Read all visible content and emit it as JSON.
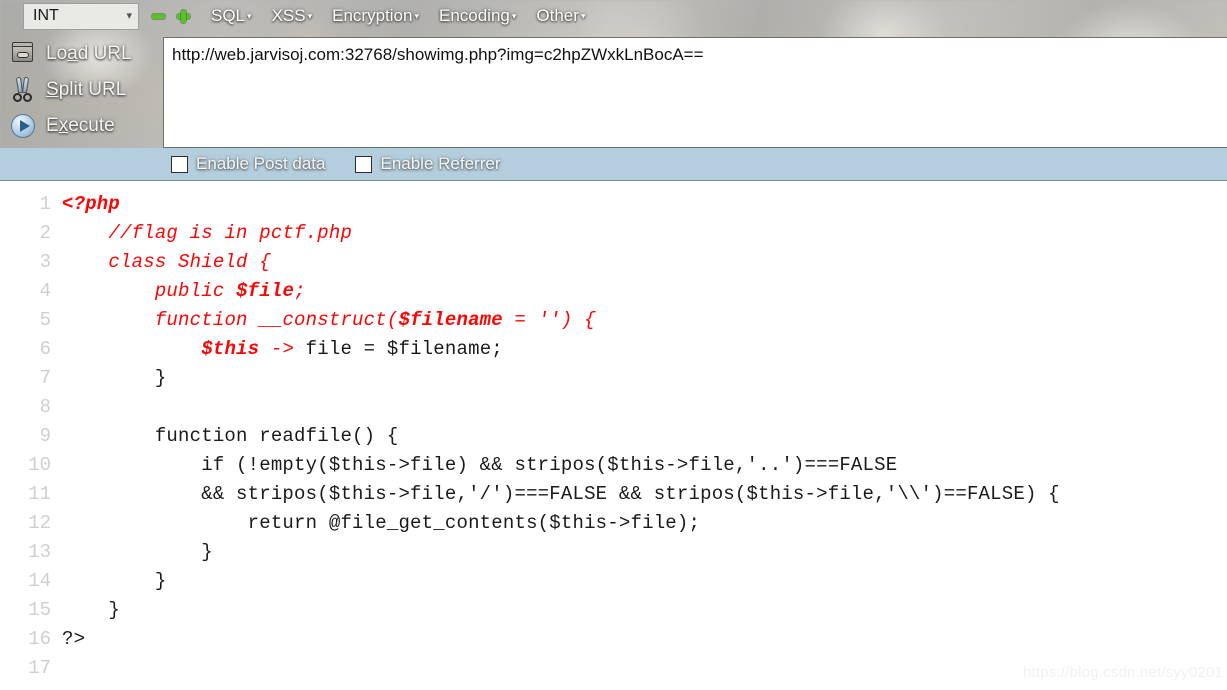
{
  "hackbar": {
    "encoding_select": {
      "value": "INT",
      "chevron": "chevron-down-icon"
    },
    "zoom_out_label": "−",
    "zoom_in_label": "+",
    "menus": [
      {
        "label": "SQL",
        "caret": "▾"
      },
      {
        "label": "XSS",
        "caret": "▾"
      },
      {
        "label": "Encryption",
        "caret": "▾"
      },
      {
        "label": "Encoding",
        "caret": "▾"
      },
      {
        "label": "Other",
        "caret": "▾"
      }
    ],
    "actions": [
      {
        "label_pre": "Lo",
        "label_key": "a",
        "label_post": "d URL",
        "icon": "load-url-icon"
      },
      {
        "label_pre": "",
        "label_key": "S",
        "label_post": "plit URL",
        "icon": "scissors-icon"
      },
      {
        "label_pre": "E",
        "label_key": "x",
        "label_post": "ecute",
        "icon": "play-circle-icon"
      }
    ],
    "url_value": "http://web.jarvisoj.com:32768/showimg.php?img=c2hpZWxkLnBocA==",
    "checkboxes": [
      {
        "label": "Enable Post data",
        "checked": false
      },
      {
        "label": "Enable Referrer",
        "checked": false
      }
    ]
  },
  "code": {
    "lines": [
      {
        "n": "1",
        "html": "<span class=\"rb\">&lt;?php</span>"
      },
      {
        "n": "2",
        "html": "    <span class=\"r\">//flag is in pctf.php</span>"
      },
      {
        "n": "3",
        "html": "    <span class=\"r\">class Shield {</span>"
      },
      {
        "n": "4",
        "html": "        <span class=\"r\">public </span><span class=\"rb\">$file</span><span class=\"r\">;</span>"
      },
      {
        "n": "5",
        "html": "        <span class=\"r\">function __construct(</span><span class=\"rb\">$filename</span><span class=\"r\"> = '') {</span>"
      },
      {
        "n": "6",
        "html": "            <span class=\"rb\">$this</span><span class=\"r\"> -&gt;</span> file = $filename;"
      },
      {
        "n": "7",
        "html": "        }"
      },
      {
        "n": "8",
        "html": ""
      },
      {
        "n": "9",
        "html": "        function readfile() {"
      },
      {
        "n": "10",
        "html": "            if (!empty($this-&gt;file) &amp;&amp; stripos($this-&gt;file,'..')===FALSE"
      },
      {
        "n": "11",
        "html": "            &amp;&amp; stripos($this-&gt;file,'/')===FALSE &amp;&amp; stripos($this-&gt;file,'\\\\')==FALSE) {"
      },
      {
        "n": "12",
        "html": "                return @file_get_contents($this-&gt;file);"
      },
      {
        "n": "13",
        "html": "            }"
      },
      {
        "n": "14",
        "html": "        }"
      },
      {
        "n": "15",
        "html": "    }"
      },
      {
        "n": "16",
        "html": "?&gt;"
      },
      {
        "n": "17",
        "html": ""
      }
    ],
    "plain": [
      "<?php",
      "    //flag is in pctf.php",
      "    class Shield {",
      "        public $file;",
      "        function __construct($filename = '') {",
      "            $this -> file = $filename;",
      "        }",
      "",
      "        function readfile() {",
      "            if (!empty($this->file) && stripos($this->file,'..')===FALSE",
      "            && stripos($this->file,'/')===FALSE && stripos($this->file,'\\\\')==FALSE) {",
      "                return @file_get_contents($this->file);",
      "            }",
      "        }",
      "    }",
      "?>",
      ""
    ]
  },
  "watermark": "https://blog.csdn.net/syy0201",
  "colors": {
    "code_red": "#fb0505",
    "checkbox_bar": "#b4cedd",
    "line_number": "#cfcfcf",
    "plus_green": "#5bc12a"
  }
}
